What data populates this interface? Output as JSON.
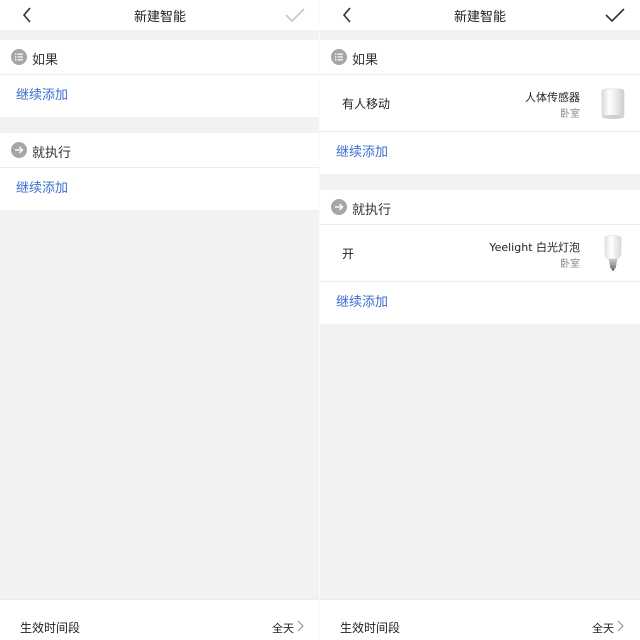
{
  "left": {
    "nav": {
      "title": "新建智能",
      "confirm_enabled": false
    },
    "if_section": {
      "title": "如果",
      "add_label": "继续添加"
    },
    "then_section": {
      "title": "就执行",
      "add_label": "继续添加"
    },
    "footer": {
      "label": "生效时间段",
      "value": "全天"
    }
  },
  "right": {
    "nav": {
      "title": "新建智能",
      "confirm_enabled": true
    },
    "if_section": {
      "title": "如果",
      "items": [
        {
          "label": "有人移动",
          "device": "人体传感器",
          "room": "卧室",
          "icon": "motion-sensor-icon"
        }
      ],
      "add_label": "继续添加"
    },
    "then_section": {
      "title": "就执行",
      "items": [
        {
          "label": "开",
          "device": "Yeelight 白光灯泡",
          "room": "卧室",
          "icon": "light-bulb-icon"
        }
      ],
      "add_label": "继续添加"
    },
    "footer": {
      "label": "生效时间段",
      "value": "全天"
    }
  },
  "colors": {
    "link": "#3b6fcf",
    "background": "#f2f2f2",
    "section_icon": "#a6a6a6"
  }
}
